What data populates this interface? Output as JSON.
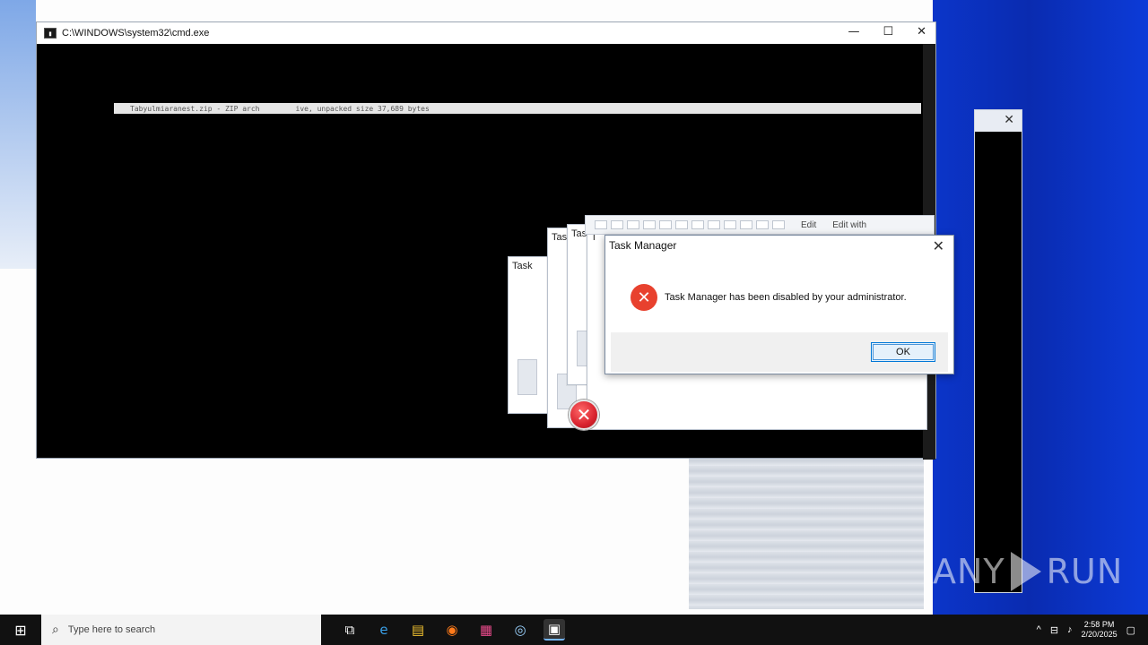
{
  "cmd": {
    "title": "C:\\WINDOWS\\system32\\cmd.exe",
    "controls": {
      "minimize": "—",
      "maximize": "☐",
      "close": "✕"
    },
    "line_left": "Tabyulmiaranest.zip - ZIP arch",
    "line_right": "ive, unpacked size 37,689 bytes"
  },
  "ghosts": {
    "t1": "Task",
    "t2": "Tas",
    "t3": "Task",
    "t4": "T"
  },
  "strip": {
    "edit": "Edit",
    "edit_with": "Edit with"
  },
  "dialog": {
    "title": "Task Manager",
    "close": "✕",
    "icon": "✕",
    "message": "Task Manager has been disabled by your administrator.",
    "ok_label": "OK"
  },
  "side_window": {
    "close": "✕"
  },
  "taskbar": {
    "start_icon": "⊞",
    "search_icon": "⌕",
    "search_placeholder": "Type here to search",
    "apps": [
      {
        "name": "task-view-icon",
        "glyph": "⧉"
      },
      {
        "name": "edge-icon",
        "glyph": "e"
      },
      {
        "name": "file-explorer-icon",
        "glyph": "▤"
      },
      {
        "name": "firefox-icon",
        "glyph": "◉"
      },
      {
        "name": "apps-grid-icon",
        "glyph": "▦"
      },
      {
        "name": "chrome-icon",
        "glyph": "◎"
      },
      {
        "name": "cmd-taskbar-icon",
        "glyph": "▣"
      }
    ],
    "tray": {
      "chevron": "^",
      "network": "⊟",
      "volume": "♪",
      "time": "2:58 PM",
      "date": "2/20/2025",
      "notification": "▢"
    }
  },
  "watermark": {
    "left": "ANY",
    "right": "RUN"
  }
}
